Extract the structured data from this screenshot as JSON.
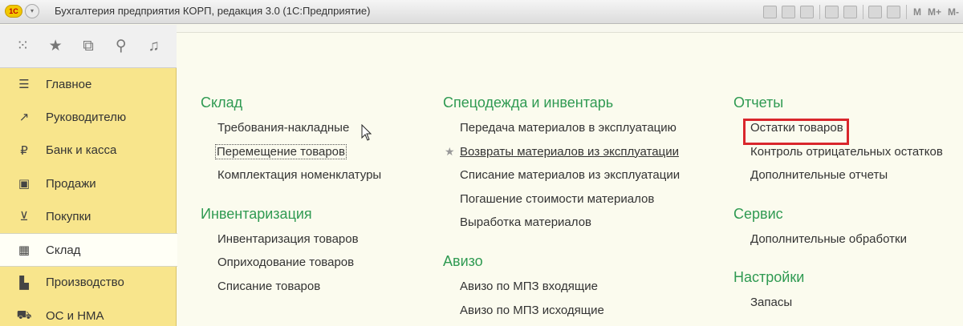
{
  "window": {
    "title": "Бухгалтерия предприятия КОРП, редакция 3.0  (1С:Предприятие)",
    "logo_text": "1С",
    "toolbar_right": [
      "M",
      "M+",
      "M-"
    ]
  },
  "toolbar_icons": [
    "apps-grid-icon",
    "star-icon",
    "history-icon",
    "search-icon",
    "bell-icon"
  ],
  "sidebar": {
    "items": [
      {
        "label": "Главное",
        "icon": "menu-lines-icon",
        "active": false
      },
      {
        "label": "Руководителю",
        "icon": "trend-icon",
        "active": false
      },
      {
        "label": "Банк и касса",
        "icon": "ruble-icon",
        "active": false
      },
      {
        "label": "Продажи",
        "icon": "bag-icon",
        "active": false
      },
      {
        "label": "Покупки",
        "icon": "cart-icon",
        "active": false
      },
      {
        "label": "Склад",
        "icon": "warehouse-grid-icon",
        "active": true
      },
      {
        "label": "Производство",
        "icon": "factory-icon",
        "active": false
      },
      {
        "label": "ОС и НМА",
        "icon": "truck-icon",
        "active": false
      }
    ]
  },
  "columns": {
    "c1": {
      "sections": [
        {
          "title": "Склад",
          "links": [
            "Требования-накладные",
            "Перемещение товаров",
            "Комплектация номенклатуры"
          ]
        },
        {
          "title": "Инвентаризация",
          "links": [
            "Инвентаризация товаров",
            "Оприходование товаров",
            "Списание товаров"
          ]
        }
      ]
    },
    "c2": {
      "sections": [
        {
          "title": "Спецодежда и инвентарь",
          "links": [
            "Передача материалов в эксплуатацию",
            "Возвраты материалов из эксплуатации",
            "Списание материалов из эксплуатации",
            "Погашение стоимости материалов",
            "Выработка материалов"
          ]
        },
        {
          "title": "Авизо",
          "links": [
            "Авизо по МПЗ входящие",
            "Авизо по МПЗ исходящие"
          ]
        }
      ]
    },
    "c3": {
      "sections": [
        {
          "title": "Отчеты",
          "links": [
            "Остатки товаров",
            "Контроль отрицательных остатков",
            "Дополнительные отчеты"
          ]
        },
        {
          "title": "Сервис",
          "links": [
            "Дополнительные обработки"
          ]
        },
        {
          "title": "Настройки",
          "links": [
            "Запасы"
          ]
        }
      ]
    }
  },
  "colors": {
    "section_title": "#2f9a52",
    "sidebar_bg": "#f8e58c",
    "highlight": "#d9262c"
  }
}
